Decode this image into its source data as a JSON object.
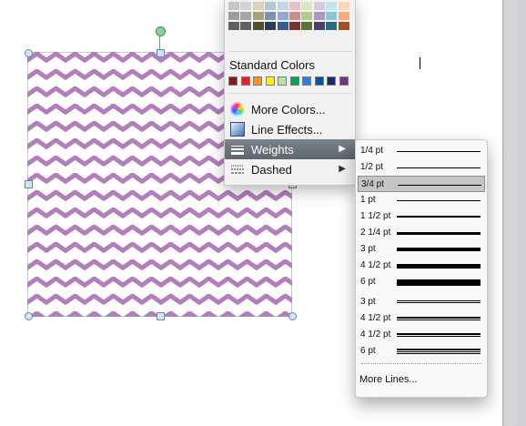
{
  "menu": {
    "standard_colors_label": "Standard Colors",
    "theme_columns": [
      [
        "#c6c6c6",
        "#9d9d9d",
        "#5f5f5f"
      ],
      [
        "#d4d4d4",
        "#a5a5a5",
        "#626262"
      ],
      [
        "#d8d3b8",
        "#a9a17a",
        "#535030"
      ],
      [
        "#b9c4d6",
        "#7f92b2",
        "#2b3a55"
      ],
      [
        "#c5d4ea",
        "#8fa9d2",
        "#365b92"
      ],
      [
        "#e5c3c1",
        "#cc8b88",
        "#7e2f2c"
      ],
      [
        "#dbe6c5",
        "#b3cb8d",
        "#5b7332"
      ],
      [
        "#d5cbe0",
        "#ab99c2",
        "#4f3d6b"
      ],
      [
        "#c3e4ec",
        "#87c6d6",
        "#2a6d80"
      ],
      [
        "#fbd6bd",
        "#f6ad7d",
        "#a4501c"
      ]
    ],
    "standard_colors": [
      "#8a1b1b",
      "#ee1c24",
      "#f7941d",
      "#fff200",
      "#b5e6a4",
      "#00a650",
      "#2e7de0",
      "#0054a6",
      "#1b2a6b",
      "#7b2f8e"
    ],
    "items": [
      {
        "label": "More Colors...",
        "icon": "color-wheel-icon"
      },
      {
        "label": "Line Effects...",
        "icon": "line-effects-icon"
      },
      {
        "label": "Weights",
        "icon": "line-weights-icon",
        "has_submenu": true,
        "active": true
      },
      {
        "label": "Dashed",
        "icon": "dashed-lines-icon",
        "has_submenu": true
      }
    ],
    "submenu_arrow": "▶"
  },
  "weights": {
    "options": [
      {
        "label": "1/4 pt",
        "weight": 0.25
      },
      {
        "label": "1/2 pt",
        "weight": 0.5
      },
      {
        "label": "3/4 pt",
        "weight": 0.75,
        "selected": true
      },
      {
        "label": "1 pt",
        "weight": 1
      },
      {
        "label": "1 1/2 pt",
        "weight": 1.5
      },
      {
        "label": "2 1/4 pt",
        "weight": 2.25
      },
      {
        "label": "3 pt",
        "weight": 3
      },
      {
        "label": "4 1/2 pt",
        "weight": 4.5
      },
      {
        "label": "6 pt",
        "weight": 6
      },
      {
        "label": "3 pt",
        "weight": 3,
        "style": "double"
      },
      {
        "label": "4 1/2 pt",
        "weight": 4.5,
        "style": "double"
      },
      {
        "label": "4 1/2 pt",
        "weight": 4.5,
        "style": "double"
      },
      {
        "label": "6 pt",
        "weight": 6,
        "style": "triple"
      }
    ],
    "more_lines_label": "More Lines..."
  },
  "shape": {
    "fill_pattern": "chevron",
    "fill_color": "#b27fbc",
    "background_color": "#ffffff",
    "outline_color": "#8a8faa"
  }
}
